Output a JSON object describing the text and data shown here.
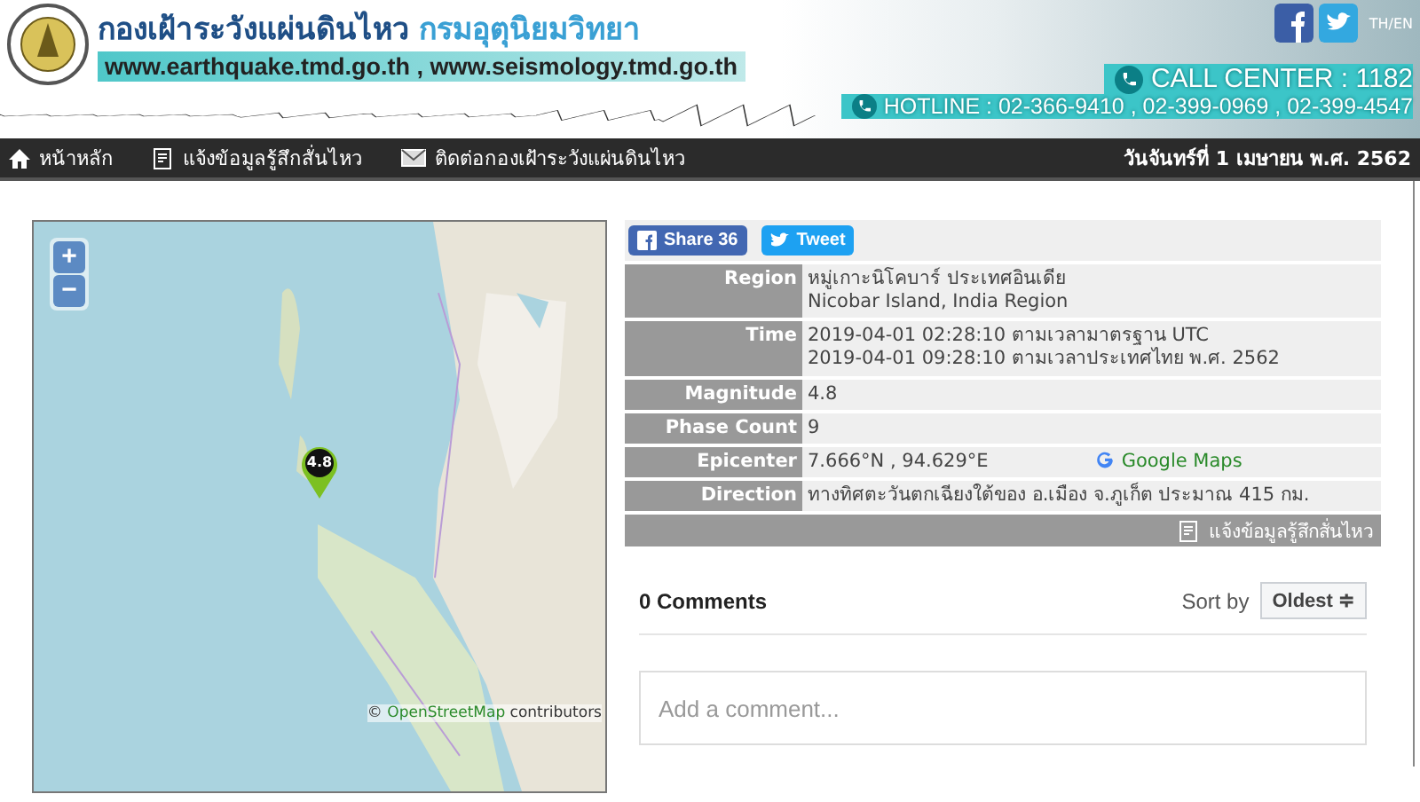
{
  "header": {
    "title": "กองเฝ้าระวังแผ่นดินไหว",
    "department": "กรมอุตุนิยมวิทยา",
    "websites": "www.earthquake.tmd.go.th , www.seismology.tmd.go.th",
    "language": "TH/EN",
    "call_center": "CALL CENTER : 1182",
    "hotline": "HOTLINE : 02-366-9410 , 02-399-0969 , 02-399-4547"
  },
  "nav": {
    "items": [
      {
        "label": "หน้าหลัก",
        "kind": "home"
      },
      {
        "label": "แจ้งข้อมูลรู้สึกสั่นไหว",
        "kind": "report"
      },
      {
        "label": "ติดต่อกองเฝ้าระวังแผ่นดินไหว",
        "kind": "mail"
      }
    ],
    "date": "วันจันทร์ที่ 1 เมษายน พ.ศ. 2562"
  },
  "map": {
    "zoom_in": "+",
    "zoom_out": "−",
    "marker_label": "4.8",
    "attribution_prefix": "©",
    "attribution_link": "OpenStreetMap",
    "attribution_suffix": "contributors"
  },
  "share": {
    "facebook": "Share 36",
    "twitter": "Tweet"
  },
  "details": [
    {
      "label": "Region",
      "lines": [
        "หมู่เกาะนิโคบาร์ ประเทศอินเดีย",
        "Nicobar Island, India Region"
      ]
    },
    {
      "label": "Time",
      "lines": [
        "2019-04-01 02:28:10 ตามเวลามาตรฐาน UTC",
        "2019-04-01 09:28:10 ตามเวลาประเทศไทย พ.ศ. 2562"
      ]
    },
    {
      "label": "Magnitude",
      "lines": [
        "4.8"
      ]
    },
    {
      "label": "Phase Count",
      "lines": [
        "9"
      ]
    },
    {
      "label": "Epicenter",
      "lines": [
        "7.666°N , 94.629°E"
      ],
      "link": "Google Maps"
    },
    {
      "label": "Direction",
      "lines": [
        "ทางทิศตะวันตกเฉียงใต้ของ อ.เมือง จ.ภูเก็ต ประมาณ 415 กม."
      ]
    }
  ],
  "report_link": "แจ้งข้อมูลรู้สึกสั่นไหว",
  "comments": {
    "count": "0 Comments",
    "sort_label": "Sort by",
    "sort_value": "Oldest ≑",
    "placeholder": "Add a comment..."
  }
}
